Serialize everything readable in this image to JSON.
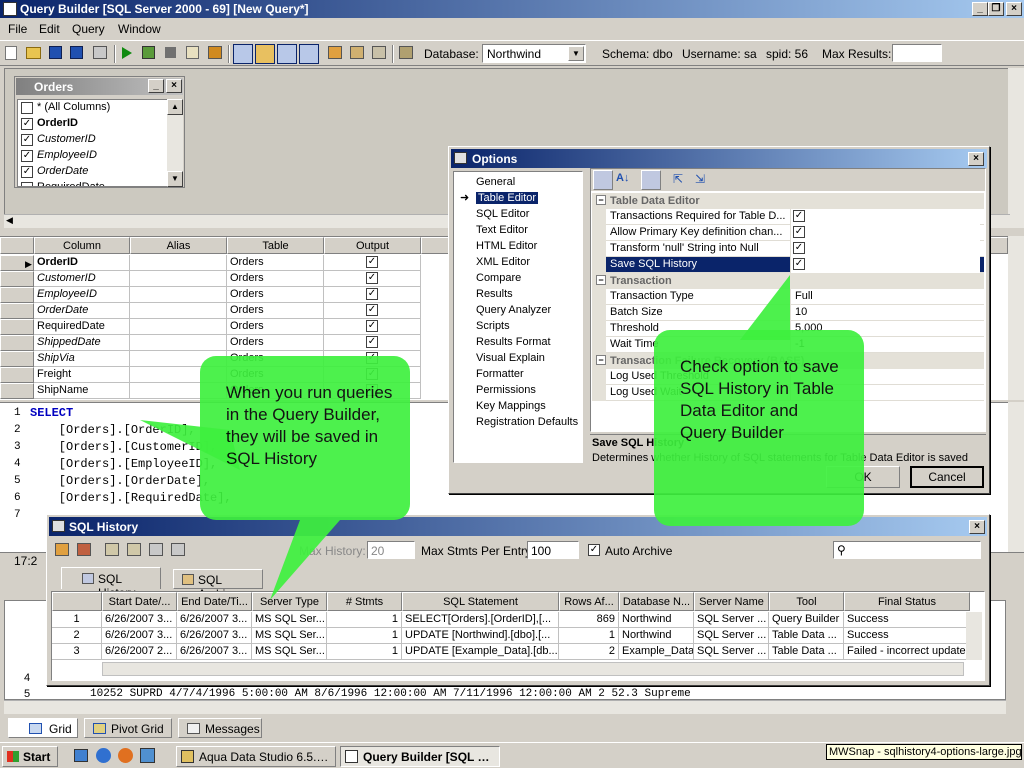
{
  "app": {
    "title": "Query Builder [SQL Server 2000 - 69] [New Query*]",
    "menu": [
      "File",
      "Edit",
      "Query",
      "Window"
    ],
    "toolbar": {
      "database_label": "Database:",
      "database_value": "Northwind",
      "schema": "Schema: dbo",
      "username": "Username: sa",
      "spid": "spid: 56",
      "max_results_label": "Max Results:"
    }
  },
  "orders_table": {
    "title": "Orders",
    "columns": [
      {
        "label": "* (All Columns)",
        "checked": false,
        "italic": false,
        "bold": false
      },
      {
        "label": "OrderID",
        "checked": true,
        "italic": false,
        "bold": true
      },
      {
        "label": "CustomerID",
        "checked": true,
        "italic": true,
        "bold": false
      },
      {
        "label": "EmployeeID",
        "checked": true,
        "italic": true,
        "bold": false
      },
      {
        "label": "OrderDate",
        "checked": true,
        "italic": true,
        "bold": false
      },
      {
        "label": "RequiredDate",
        "checked": false,
        "italic": false,
        "bold": false
      }
    ]
  },
  "column_grid": {
    "headers": [
      "Column",
      "Alias",
      "Table",
      "Output"
    ],
    "rows": [
      {
        "column": "OrderID",
        "table": "Orders",
        "bold": true,
        "italic": false,
        "current": true
      },
      {
        "column": "CustomerID",
        "table": "Orders",
        "bold": false,
        "italic": true
      },
      {
        "column": "EmployeeID",
        "table": "Orders",
        "bold": false,
        "italic": true
      },
      {
        "column": "OrderDate",
        "table": "Orders",
        "bold": false,
        "italic": true
      },
      {
        "column": "RequiredDate",
        "table": "Orders",
        "bold": false,
        "italic": false
      },
      {
        "column": "ShippedDate",
        "table": "Orders",
        "bold": false,
        "italic": true
      },
      {
        "column": "ShipVia",
        "table": "Orders",
        "bold": false,
        "italic": true
      },
      {
        "column": "Freight",
        "table": "Orders",
        "bold": false,
        "italic": false
      },
      {
        "column": "ShipName",
        "table": "Orders",
        "bold": false,
        "italic": false
      }
    ]
  },
  "sql_editor": {
    "lines": [
      {
        "num": "1",
        "text": "SELECT",
        "keyword": true
      },
      {
        "num": "2",
        "text": "    [Orders].[OrderID],",
        "keyword": false
      },
      {
        "num": "3",
        "text": "    [Orders].[CustomerID],",
        "keyword": false
      },
      {
        "num": "4",
        "text": "    [Orders].[EmployeeID],",
        "keyword": false
      },
      {
        "num": "5",
        "text": "    [Orders].[OrderDate],",
        "keyword": false
      },
      {
        "num": "6",
        "text": "    [Orders].[RequiredDate],",
        "keyword": false
      },
      {
        "num": "7",
        "text": "",
        "keyword": false
      }
    ],
    "status": "17:2"
  },
  "results_row": {
    "row_nums": [
      "4",
      "5"
    ],
    "text": "10252 SUPRD          4/7/4/1996 5:00:00 AM    8/6/1996 12:00:00 AM    7/11/1996 12:00:00 AM        2    52.3 Supreme"
  },
  "bottom_tabs": [
    "Grid",
    "Pivot Grid",
    "Messages"
  ],
  "options_dialog": {
    "title": "Options",
    "categories": [
      "General",
      "Table Editor",
      "SQL Editor",
      "Text Editor",
      "HTML Editor",
      "XML Editor",
      "Compare",
      "Results",
      "Query Analyzer",
      "Scripts",
      "Results Format",
      "Visual Explain",
      "Formatter",
      "Permissions",
      "Key Mappings",
      "Registration Defaults"
    ],
    "selected_category": "Table Editor",
    "sections": [
      {
        "name": "Table Data Editor",
        "props": [
          {
            "name": "Transactions Required for Table D...",
            "value": "",
            "check": true
          },
          {
            "name": "Allow Primary Key definition chan...",
            "value": "",
            "check": true
          },
          {
            "name": "Transform 'null' String into Null",
            "value": "",
            "check": true
          },
          {
            "name": "Save SQL History",
            "value": "",
            "check": true,
            "selected": true
          }
        ]
      },
      {
        "name": "Transaction",
        "props": [
          {
            "name": "Transaction Type",
            "value": "Full"
          },
          {
            "name": "Batch Size",
            "value": "10"
          },
          {
            "name": "Threshold",
            "value": "5,000"
          },
          {
            "name": "Wait Time",
            "value": "-1"
          }
        ]
      },
      {
        "name": "Transaction Failure Recovery (BASE)",
        "props": [
          {
            "name": "Log Used Threshold",
            "value": ""
          },
          {
            "name": "Log Used Wait",
            "value": ""
          }
        ]
      }
    ],
    "description_title": "Save SQL History",
    "description_text": "Determines whether History of SQL statements for Table Data Editor is saved",
    "ok_label": "OK",
    "cancel_label": "Cancel"
  },
  "sql_history": {
    "title": "SQL History",
    "max_history_label": "Max History:",
    "max_history_value": "20",
    "max_stmts_label": "Max Stmts Per Entry:",
    "max_stmts_value": "100",
    "auto_archive_label": "Auto Archive",
    "tabs": [
      "SQL History",
      "SQL Archive"
    ],
    "headers": [
      "",
      "Start Date/...",
      "End Date/Ti...",
      "Server Type",
      "# Stmts",
      "SQL Statement",
      "Rows Af...",
      "Database N...",
      "Server Name",
      "Tool",
      "Final Status"
    ],
    "rows": [
      [
        "1",
        "6/26/2007 3...",
        "6/26/2007 3...",
        "MS SQL Ser...",
        "1",
        "SELECT[Orders].[OrderID],[...",
        "869",
        "Northwind",
        "SQL Server ...",
        "Query Builder",
        "Success"
      ],
      [
        "2",
        "6/26/2007 3...",
        "6/26/2007 3...",
        "MS SQL Ser...",
        "1",
        "UPDATE [Northwind].[dbo].[...",
        "1",
        "Northwind",
        "SQL Server ...",
        "Table Data ...",
        "Success"
      ],
      [
        "3",
        "6/26/2007 2...",
        "6/26/2007 3...",
        "MS SQL Ser...",
        "1",
        "UPDATE [Example_Data].[db...",
        "2",
        "Example_Data",
        "SQL Server ...",
        "Table Data ...",
        "Failed - incorrect update"
      ]
    ]
  },
  "callouts": {
    "left": "When you run queries in the Query Builder, they will be saved in SQL History",
    "right": "Check option to save SQL History in Table Data Editor and Query Builder"
  },
  "taskbar": {
    "start": "Start",
    "buttons": [
      "Aqua Data Studio 6.5.0 [...",
      "Query Builder [SQL Ser..."
    ],
    "tray_text": "MWSnap - sqlhistory4-options-large.jpg"
  }
}
